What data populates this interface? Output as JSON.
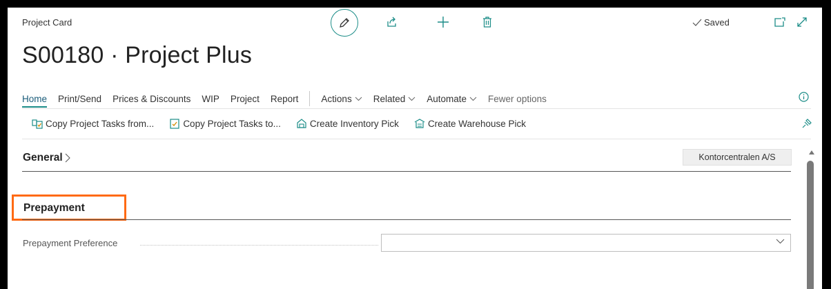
{
  "header": {
    "caption": "Project Card",
    "saved_label": "Saved",
    "title": "S00180 · Project Plus"
  },
  "menu": {
    "items": [
      "Home",
      "Print/Send",
      "Prices & Discounts",
      "WIP",
      "Project",
      "Report"
    ],
    "dropdowns": [
      "Actions",
      "Related",
      "Automate"
    ],
    "fewer_options": "Fewer options"
  },
  "actions": [
    "Copy Project Tasks from...",
    "Copy Project Tasks to...",
    "Create Inventory Pick",
    "Create Warehouse Pick"
  ],
  "general": {
    "label": "General",
    "customer_chip": "Kontorcentralen A/S"
  },
  "prepayment": {
    "label": "Prepayment",
    "field_label": "Prepayment Preference",
    "field_value": ""
  },
  "colors": {
    "accent": "#1a8c87",
    "highlight": "#ff6a13"
  }
}
